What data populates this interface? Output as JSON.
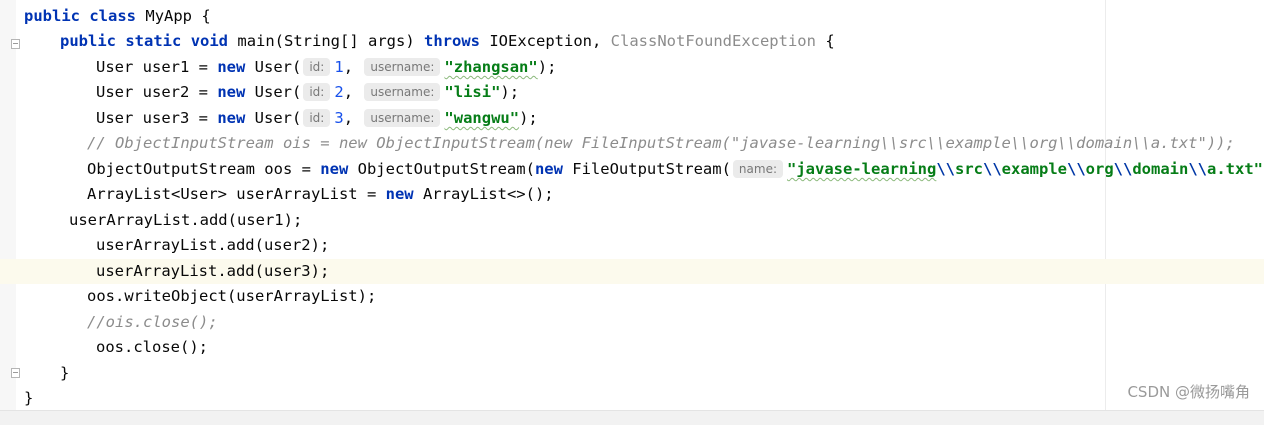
{
  "code": {
    "l1": {
      "kw1": "public",
      "kw2": "class",
      "name": "MyApp {"
    },
    "l2": {
      "kw1": "public",
      "kw2": "static",
      "kw3": "void",
      "sig": "main(String[] args) ",
      "kw4": "throws",
      "ex1": "IOException, ",
      "ex2": "ClassNotFoundException",
      "tail": " {"
    },
    "l3": {
      "pre": "User user1 = ",
      "kw": "new",
      "ctor": "User(",
      "hint1": "id:",
      "num": "1",
      "sep": ", ",
      "hint2": "username:",
      "str": "\"zhangsan\"",
      "tail": ");"
    },
    "l4": {
      "pre": "User user2 = ",
      "kw": "new",
      "ctor": "User(",
      "hint1": "id:",
      "num": "2",
      "sep": ", ",
      "hint2": "username:",
      "str": "\"lisi\"",
      "tail": ");"
    },
    "l5": {
      "pre": "User user3 = ",
      "kw": "new",
      "ctor": "User(",
      "hint1": "id:",
      "num": "3",
      "sep": ", ",
      "hint2": "username:",
      "str": "\"wangwu\"",
      "tail": ");"
    },
    "l6": {
      "text": "// ObjectInputStream ois = new ObjectInputStream(new FileInputStream(\"javase-learning\\\\src\\\\example\\\\org\\\\domain\\\\a.txt\"));"
    },
    "l7": {
      "pre": "ObjectOutputStream oos = ",
      "kw1": "new",
      "mid": " ObjectOutputStream(",
      "kw2": "new",
      "ctor": " FileOutputStream(",
      "hint": "name:",
      "s1": "\"javase-learning",
      "e1": "\\\\",
      "s2": "src",
      "e2": "\\\\",
      "s3": "example",
      "e3": "\\\\",
      "s4": "org",
      "e4": "\\\\",
      "s5": "domain",
      "e5": "\\\\",
      "s6": "a.txt\"",
      "tail": "));"
    },
    "l8": {
      "pre": "ArrayList<User> userArrayList = ",
      "kw": "new",
      "tail": " ArrayList<>();"
    },
    "l9": {
      "text": "userArrayList.add(user1);"
    },
    "l10": {
      "text": "userArrayList.add(user2);"
    },
    "l11": {
      "text": "userArrayList.add(user3);"
    },
    "l12": {
      "text": "oos.writeObject(userArrayList);"
    },
    "l13": {
      "text": "//ois.close();"
    },
    "l14": {
      "text": "oos.close();"
    },
    "l15": {
      "text": "}"
    },
    "l16": {
      "text": "}"
    }
  },
  "watermark": "CSDN @微扬嘴角"
}
